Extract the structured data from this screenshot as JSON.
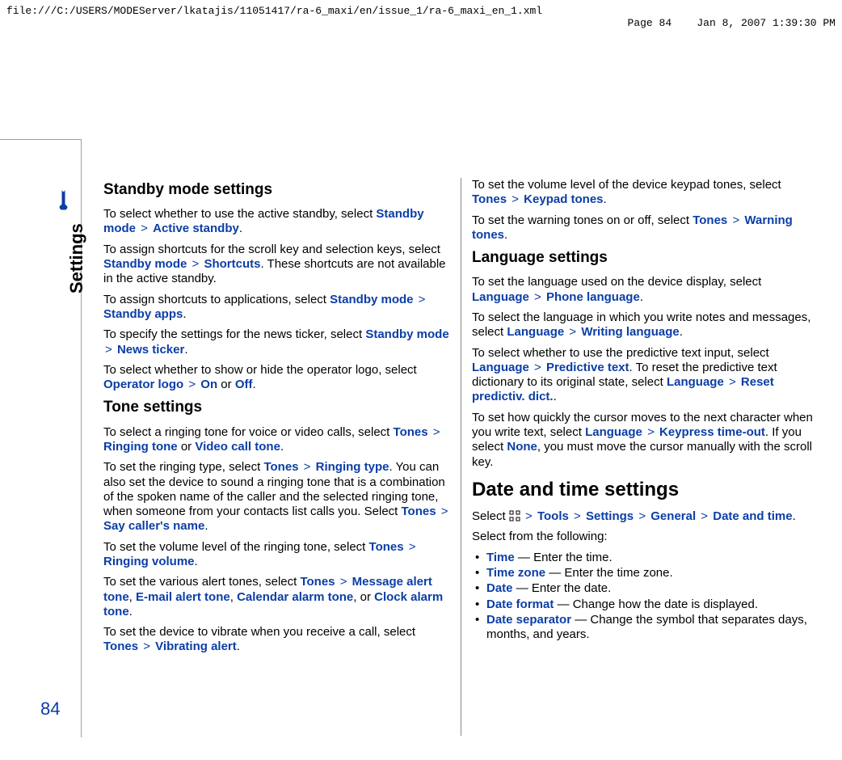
{
  "header": {
    "path": "file:///C:/USERS/MODEServer/lkatajis/11051417/ra-6_maxi/en/issue_1/ra-6_maxi_en_1.xml",
    "pagelabel": "Page 84",
    "timestamp": "Jan 8, 2007 1:39:30 PM"
  },
  "rail": {
    "tab": "Settings",
    "pagenum": "84"
  },
  "col1": {
    "h_standby": "Standby mode settings",
    "p1a": "To select whether to use the active standby, select ",
    "p1b": "Standby mode",
    "p1c": "Active standby",
    "p1d": ".",
    "p2a": "To assign shortcuts for the scroll key and selection keys, select ",
    "p2b": "Standby mode",
    "p2c": "Shortcuts",
    "p2d": ". These shortcuts are not available in the active standby.",
    "p3a": "To assign shortcuts to applications, select ",
    "p3b": "Standby mode",
    "p3c": "Standby apps",
    "p3d": ".",
    "p4a": "To specify the settings for the news ticker, select ",
    "p4b": "Standby mode",
    "p4c": "News ticker",
    "p4d": ".",
    "p5a": "To select whether to show or hide the operator logo, select ",
    "p5b": "Operator logo",
    "p5c": "On",
    "p5or": " or ",
    "p5d": "Off",
    "p5e": ".",
    "h_tone": "Tone settings",
    "p6a": "To select a ringing tone for voice or video calls, select ",
    "p6b": "Tones",
    "p6c": "Ringing tone",
    "p6or": " or ",
    "p6d": "Video call tone",
    "p6e": ".",
    "p7a": "To set the ringing type, select ",
    "p7b": "Tones",
    "p7c": "Ringing type",
    "p7d": ". You can also set the device to sound a ringing tone that is a combination of the spoken name of the caller and the selected ringing tone, when someone from your contacts list calls you. Select ",
    "p7e": "Tones",
    "p7f": "Say caller's name",
    "p7g": ".",
    "p8a": "To set the volume level of the ringing tone, select ",
    "p8b": "Tones",
    "p8c": "Ringing volume",
    "p8d": ".",
    "p9a": "To set the various alert tones, select ",
    "p9b": "Tones",
    "p9c": "Message alert tone",
    "p9d": ", ",
    "p9e": "E-mail alert tone",
    "p9f": ", ",
    "p9g": "Calendar alarm tone",
    "p9h": ", or ",
    "p9i": "Clock alarm tone",
    "p9j": ".",
    "p10a": "To set the device to vibrate when you receive a call, select ",
    "p10b": "Tones",
    "p10c": "Vibrating alert",
    "p10d": "."
  },
  "col2": {
    "p11a": "To set the volume level of the device keypad tones, select ",
    "p11b": "Tones",
    "p11c": "Keypad tones",
    "p11d": ".",
    "p12a": "To set the warning tones on or off, select ",
    "p12b": "Tones",
    "p12c": "Warning tones",
    "p12d": ".",
    "h_lang": "Language settings",
    "p13a": "To set the language used on the device display, select ",
    "p13b": "Language",
    "p13c": "Phone language",
    "p13d": ".",
    "p14a": "To select the language in which you write notes and messages, select ",
    "p14b": "Language",
    "p14c": "Writing language",
    "p14d": ".",
    "p15a": "To select whether to use the predictive text input, select ",
    "p15b": "Language",
    "p15c": "Predictive text",
    "p15d": ". To reset the predictive text dictionary to its original state, select ",
    "p15e": "Language",
    "p15f": "Reset predictiv. dict.",
    "p15g": ".",
    "p16a": "To set how quickly the cursor moves to the next character when you write text, select ",
    "p16b": "Language",
    "p16c": "Keypress time-out",
    "p16d": ". If you select ",
    "p16e": "None",
    "p16f": ", you must move the cursor manually with the scroll key.",
    "h_date": "Date and time settings",
    "p17a": "Select ",
    "p17b": "Tools",
    "p17c": "Settings",
    "p17d": "General",
    "p17e": "Date and time",
    "p17f": ".",
    "p18": "Select from the following:",
    "li1a": "Time",
    "li1b": " — Enter the time.",
    "li2a": "Time zone",
    "li2b": " — Enter the time zone.",
    "li3a": "Date",
    "li3b": " — Enter the date.",
    "li4a": "Date format",
    "li4b": " — Change how the date is displayed.",
    "li5a": "Date separator",
    "li5b": " — Change the symbol that separates days, months, and years."
  }
}
